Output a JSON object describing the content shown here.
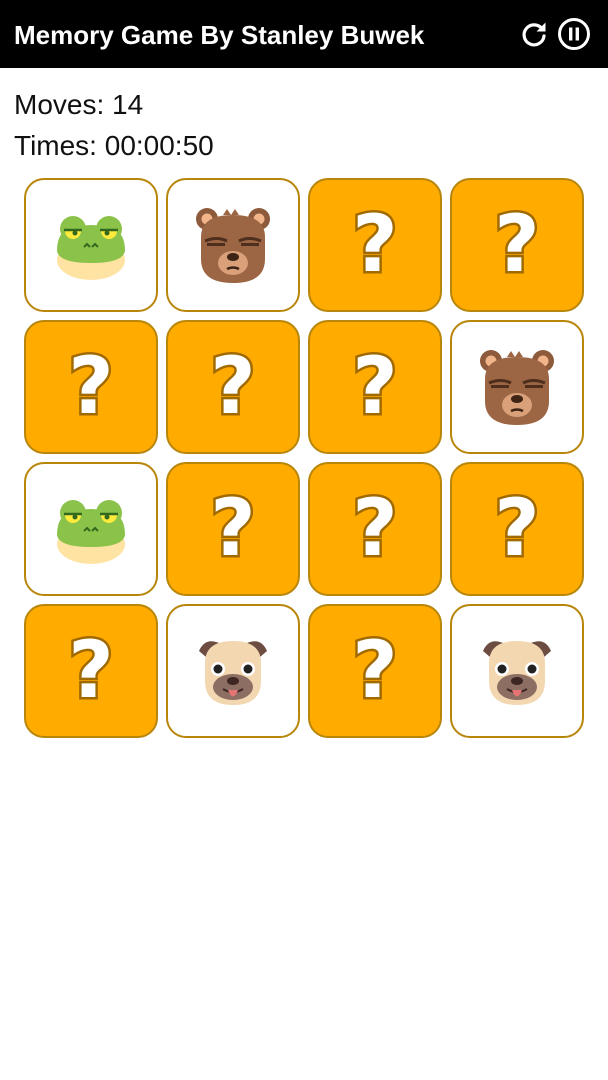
{
  "app_bar": {
    "title": "Memory Game By Stanley Buwek",
    "restart_icon": "restart-icon",
    "pause_icon": "pause-icon"
  },
  "stats": {
    "moves_label": "Moves: 14",
    "time_label": "Times: 00:00:50"
  },
  "colors": {
    "app_bar": "#000000",
    "card_hidden": "#ffab00",
    "card_border": "#b8860b",
    "card_revealed": "#ffffff"
  },
  "board": {
    "columns": 4,
    "rows": 4,
    "hidden_symbol": "?",
    "cards": [
      {
        "state": "revealed",
        "face": "frog"
      },
      {
        "state": "revealed",
        "face": "bear"
      },
      {
        "state": "hidden",
        "face": ""
      },
      {
        "state": "hidden",
        "face": ""
      },
      {
        "state": "hidden",
        "face": ""
      },
      {
        "state": "hidden",
        "face": ""
      },
      {
        "state": "hidden",
        "face": ""
      },
      {
        "state": "revealed",
        "face": "bear"
      },
      {
        "state": "revealed",
        "face": "frog"
      },
      {
        "state": "hidden",
        "face": ""
      },
      {
        "state": "hidden",
        "face": ""
      },
      {
        "state": "hidden",
        "face": ""
      },
      {
        "state": "hidden",
        "face": ""
      },
      {
        "state": "revealed",
        "face": "pug"
      },
      {
        "state": "hidden",
        "face": ""
      },
      {
        "state": "revealed",
        "face": "pug"
      }
    ]
  }
}
